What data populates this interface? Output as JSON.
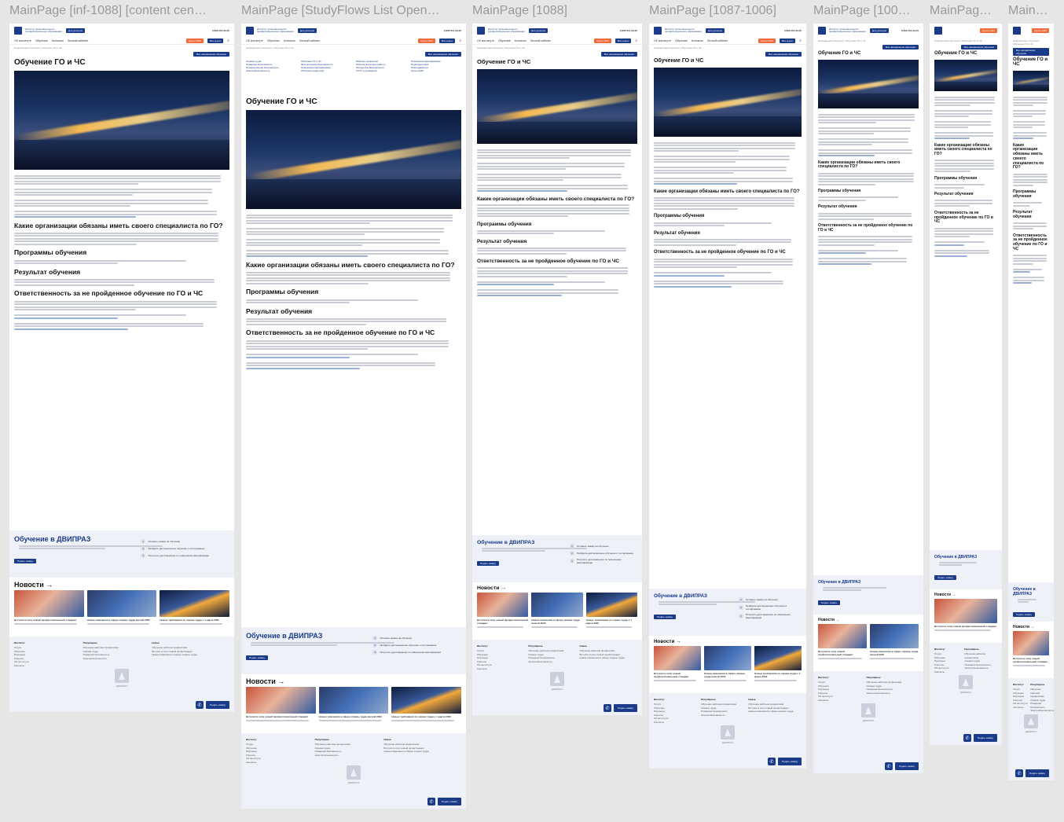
{
  "frames": [
    {
      "id": "f1",
      "title": "MainPage [inf-1088] [content cen…"
    },
    {
      "id": "f2",
      "title": "MainPage [StudyFlows List Open…"
    },
    {
      "id": "f3",
      "title": "MainPage [1088]"
    },
    {
      "id": "f4",
      "title": "MainPage [1087-1006]"
    },
    {
      "id": "f5",
      "title": "MainPage [100…"
    },
    {
      "id": "f6",
      "title": "MainPag…"
    },
    {
      "id": "f7",
      "title": "Main…"
    }
  ],
  "site": {
    "logo_text": "Институт дополнительного профессионального образования",
    "brand": "ДВИПРАЗ",
    "header_btn": "Для дилеров",
    "phone": "8 800 551-20-25",
    "phone_alt": "+7 (423) 240-42-65",
    "btn_orange": "Курсы 2022",
    "btn_blue": "Все курсы",
    "nav": [
      "Об институте",
      "Обучение",
      "Контакты",
      "Личный кабинет"
    ],
    "breadcrumb": "Направления обучения / Обучение ГО и ЧС",
    "date": "22 августа 2022",
    "all_directions": "Все направления обучения"
  },
  "article": {
    "title": "Обучение ГО и ЧС",
    "h_orgs": "Какие организации обязаны иметь своего специалиста по ГО?",
    "h_programs": "Программы обучения",
    "h_result": "Результат обучения",
    "h_resp": "Ответственность за не пройденное обучение по ГО и ЧС"
  },
  "promo": {
    "title": "Обучение в ДВИПРАЗ",
    "button": "Подать заявку",
    "steps": [
      {
        "n": "1",
        "t": "Оставьте заявку на обучение"
      },
      {
        "n": "2",
        "t": "Пройдите дистанционное обучение и тестирование"
      },
      {
        "n": "3",
        "t": "Получите удостоверение по повышению квалификации"
      }
    ]
  },
  "news": {
    "title": "Новости →",
    "items": [
      "Вступил в силу новый профессиональный стандарт",
      "Новые изменения в сфере охраны труда весной 2022",
      "Новые требования по охране труда с 1 марта 2022"
    ]
  },
  "footer": {
    "col1_head": "Институт",
    "col1": [
      "Услуги",
      "Обучение",
      "Партнеры",
      "Клиенты",
      "Об институте",
      "Контакты"
    ],
    "col2_head": "Популярное",
    "col2": [
      "Обучение рабочим профессиям",
      "Охрана труда",
      "Пожарная безопасность",
      "Электробезопасность"
    ],
    "col3_head": "Новое",
    "col3": [
      "Обучение рабочим профессиям",
      "Вступил в силу новый профстандарт",
      "Новые изменения в сфере охраны труда"
    ],
    "fab_label": "Подать заявку"
  },
  "subnav": {
    "cols": [
      [
        "Охрана труда",
        "Пожарная безопасность",
        "Промышленная безопасность",
        "Электробезопасность"
      ],
      [
        "Обучение ГО и ЧС",
        "Экологическая безопасность",
        "Повышение квалификации",
        "Обучение водителей"
      ],
      [
        "Рабочие профессии",
        "Рабочие высотные работы",
        "Экспертиза безопасности",
        "СОУТ и профриски"
      ],
      [
        "Повышение квалификации",
        "Переподготовка",
        "Преподаватели",
        "Курсы 2022"
      ]
    ]
  },
  "colors": {
    "brand": "#1a3a8a",
    "accent": "#f26b3a",
    "soft": "#eef1f8"
  }
}
